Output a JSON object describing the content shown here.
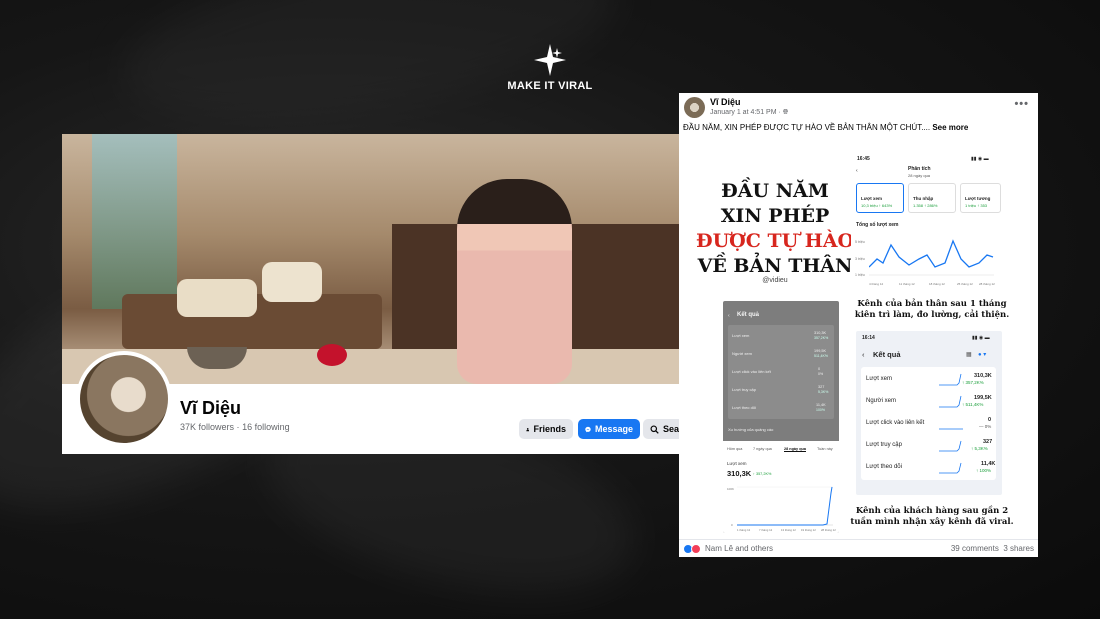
{
  "logo": {
    "brand": "MAKE IT VIRAL",
    "icon": "sparkle-star-icon"
  },
  "profile": {
    "name": "Vĩ Diệu",
    "followers": "37K followers",
    "separator": "·",
    "following": "16 following",
    "buttons": {
      "friends": "Friends",
      "message": "Message",
      "search": "Sear"
    }
  },
  "post": {
    "author": "Vĩ Diệu",
    "time": "January 1 at 4:51 PM ·",
    "caption": "ĐẦU NĂM, XIN PHÉP ĐƯỢC TỰ HÀO VỀ BẢN THÂN MỘT CHÚT....",
    "see_more": "See more",
    "image": {
      "headline_1": "ĐẦU NĂM",
      "headline_2": "XIN PHÉP",
      "headline_3": "ĐƯỢC TỰ HÀO",
      "headline_4": "VỀ BẢN THÂN",
      "handle": "@vidieu",
      "caption_top_1": "Kênh của bản thân sau 1 tháng",
      "caption_top_2": "kiên trì làm, đo lường, cải thiện.",
      "caption_bottom_1": "Kênh của khách hàng sau gần 2",
      "caption_bottom_2": "tuần mình nhận xây kênh đã viral.",
      "analytics_top": {
        "clock": "16:45",
        "title": "Phân tích",
        "subtitle": "28 ngày qua",
        "tab1": "Lượt xem",
        "tab1_val": "10,3 triệu ↑ 643%",
        "tab2": "Thu nhập",
        "tab2_val": "1.358 ↑ 286%",
        "tab3": "Lượt tương",
        "tab3_val": "1 triệu ↑ 353",
        "chart_title": "Tổng số lượt xem",
        "y_labels": [
          "1 triệu",
          "3 triệu",
          "5 triệu"
        ],
        "x_labels": [
          "4 tháng 12",
          "11 tháng 12",
          "18 tháng 12",
          "25 tháng 12",
          "28 tháng 12"
        ]
      },
      "analytics_left": {
        "title": "Kết quả",
        "rows": [
          {
            "label": "Lượt xem",
            "value": "310,3K",
            "delta": "357,2K%"
          },
          {
            "label": "Người xem",
            "value": "199,5K",
            "delta": "511,4K%"
          },
          {
            "label": "Lượt click vào liên kết",
            "value": "0",
            "delta": "0%"
          },
          {
            "label": "Lượt truy cập",
            "value": "327",
            "delta": "5,3K%"
          },
          {
            "label": "Lượt theo dõi",
            "value": "11,4K",
            "delta": "100%"
          }
        ],
        "trend_title": "Xu hướng của quảng cáo",
        "filters": [
          "Hôm qua",
          "7 ngày qua",
          "28 ngày qua",
          "Tuần này"
        ],
        "metric_label": "Lượt xem",
        "metric_value": "310,3K",
        "metric_delta": "↑ 357,2K%",
        "y_labels": [
          "100K",
          "0"
        ],
        "x_labels": [
          "1 tháng 12",
          "7 tháng 12",
          "13 tháng 12",
          "19 tháng 12",
          "28 tháng 12"
        ]
      },
      "analytics_right": {
        "clock": "16:14",
        "title": "Kết quả",
        "rows": [
          {
            "label": "Lượt xem",
            "value": "310,3K",
            "delta": "↑ 357,2K%"
          },
          {
            "label": "Người xem",
            "value": "199,5K",
            "delta": "↑ 511,4K%"
          },
          {
            "label": "Lượt click vào liên kết",
            "value": "0",
            "delta": "— 0%"
          },
          {
            "label": "Lượt truy cập",
            "value": "327",
            "delta": "↑ 5,3K%"
          },
          {
            "label": "Lượt theo dõi",
            "value": "11,4K",
            "delta": "↑ 100%"
          }
        ]
      }
    },
    "likers": "Nam Lê and others",
    "comments": "39 comments",
    "shares": "3 shares"
  },
  "colors": {
    "facebook_blue": "#1877f2",
    "headline_red": "#d7261e",
    "positive_green": "#1a9e3a"
  }
}
